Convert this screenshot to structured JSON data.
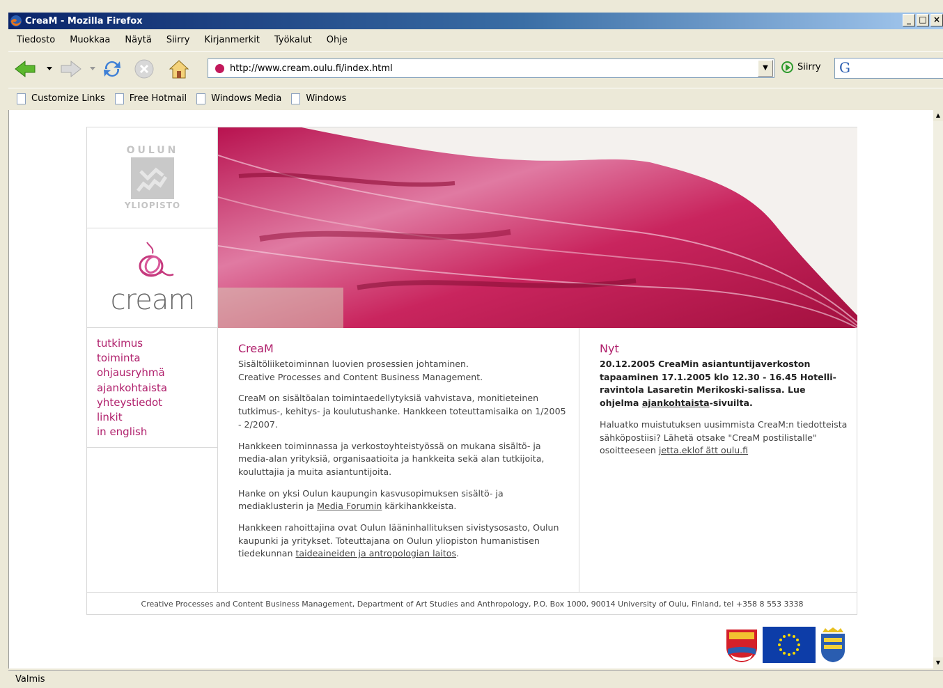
{
  "window": {
    "title": "CreaM - Mozilla Firefox",
    "min": "_",
    "max": "□",
    "close": "×"
  },
  "menu": [
    "Tiedosto",
    "Muokkaa",
    "Näytä",
    "Siirry",
    "Kirjanmerkit",
    "Työkalut",
    "Ohje"
  ],
  "toolbar": {
    "url": "http://www.cream.oulu.fi/index.html",
    "go_label": "Siirry",
    "search_glyph": "G"
  },
  "links": [
    "Customize Links",
    "Free Hotmail",
    "Windows Media",
    "Windows"
  ],
  "status": "Valmis",
  "site": {
    "oulu_top": "OULUN",
    "oulu_bottom": "YLIOPISTO",
    "logo_word": "cream",
    "nav": [
      "tutkimus",
      "toiminta",
      "ohjausryhmä",
      "ajankohtaista",
      "yhteystiedot",
      "linkit",
      "in english"
    ],
    "main": {
      "heading": "CreaM",
      "intro_fi": "Sisältöliiketoiminnan luovien prosessien johtaminen.",
      "intro_en": "Creative Processes and Content Business Management.",
      "p1": "CreaM on sisältöalan toimintaedellytyksiä vahvistava, monitieteinen tutkimus-, kehitys- ja koulutushanke. Hankkeen toteuttamisaika on 1/2005 - 2/2007.",
      "p2": "Hankkeen toiminnassa ja verkostoyhteistyössä on mukana sisältö- ja media-alan yrityksiä, organisaatioita ja hankkeita sekä alan tutkijoita, kouluttajia ja muita asiantuntijoita.",
      "p3_pre": "Hanke on yksi Oulun kaupungin kasvusopimuksen sisältö- ja mediaklusterin ja ",
      "p3_link": "Media Forumin",
      "p3_post": " kärkihankkeista.",
      "p4_pre": "Hankkeen rahoittajina ovat Oulun lääninhallituksen sivistysosasto, Oulun kaupunki ja yritykset. Toteuttajana on Oulun yliopiston humanistisen tiedekunnan ",
      "p4_link": "taideaineiden ja antropologian laitos",
      "p4_post": "."
    },
    "news": {
      "heading": "Nyt",
      "bold_pre": "20.12.2005 CreaMin asiantuntijaverkoston tapaaminen 17.1.2005 klo 12.30 - 16.45 Hotelli-ravintola Lasaretin Merikoski-salissa. Lue ohjelma ",
      "bold_link": "ajankohtaista",
      "bold_post": "-sivuilta.",
      "p_pre": "Haluatko muistutuksen uusimmista CreaM:n tiedotteista sähköpostiisi? Lähetä otsake \"CreaM postilistalle\" osoitteeseen ",
      "p_link": "jetta.eklof ätt oulu.fi"
    },
    "footer": "Creative Processes and Content Business Management, Department of Art Studies and Anthropology, P.O. Box 1000, 90014 University of Oulu, Finland, tel +358 8 553 3338"
  },
  "colors": {
    "accent": "#b0206c",
    "titlebar": "#0a246a",
    "chrome": "#ece9d8"
  }
}
